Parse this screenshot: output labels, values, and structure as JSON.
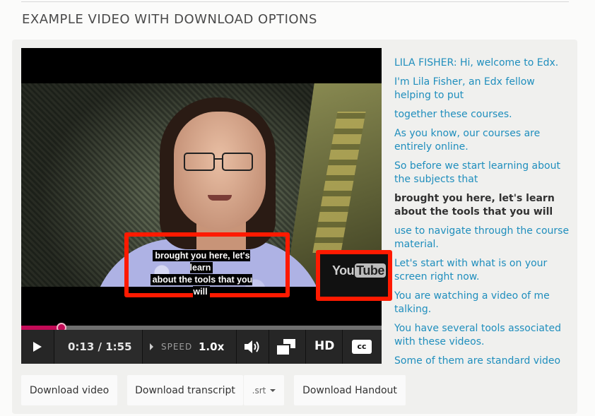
{
  "section": {
    "title": "EXAMPLE VIDEO WITH DOWNLOAD OPTIONS"
  },
  "video": {
    "caption_line1": "brought you here, let's learn",
    "caption_line2": "about the tools that you will",
    "watermark_you": "You",
    "watermark_tube": "Tube",
    "progress_fraction": 0.112,
    "highlight_color": "#ff1a00",
    "progress_color": "#c30b57"
  },
  "controls": {
    "time": "0:13 / 1:55",
    "speed_label": "SPEED",
    "speed_value": "1.0x",
    "hd_label": "HD",
    "cc_label": "cc",
    "play_icon": "play-icon",
    "volume_icon": "volume-icon",
    "fullscreen_icon": "fullscreen-icon"
  },
  "transcript": {
    "lines": [
      "LILA FISHER: Hi, welcome to Edx.",
      "I'm Lila Fisher, an Edx fellow helping to put",
      "together these courses.",
      "As you know, our courses are entirely online.",
      "So before we start learning about the subjects that",
      "brought you here, let's learn about the tools that you will",
      "use to navigate through the course material.",
      "Let's start with what is on your screen right now.",
      "You are watching a video of me talking.",
      "You have several tools associated with these videos.",
      "Some of them are standard video"
    ],
    "current_index": 5,
    "link_color": "#1f8ebd"
  },
  "downloads": {
    "video_label": "Download video",
    "transcript_label": "Download transcript",
    "format_label": ".srt",
    "handout_label": "Download Handout"
  }
}
